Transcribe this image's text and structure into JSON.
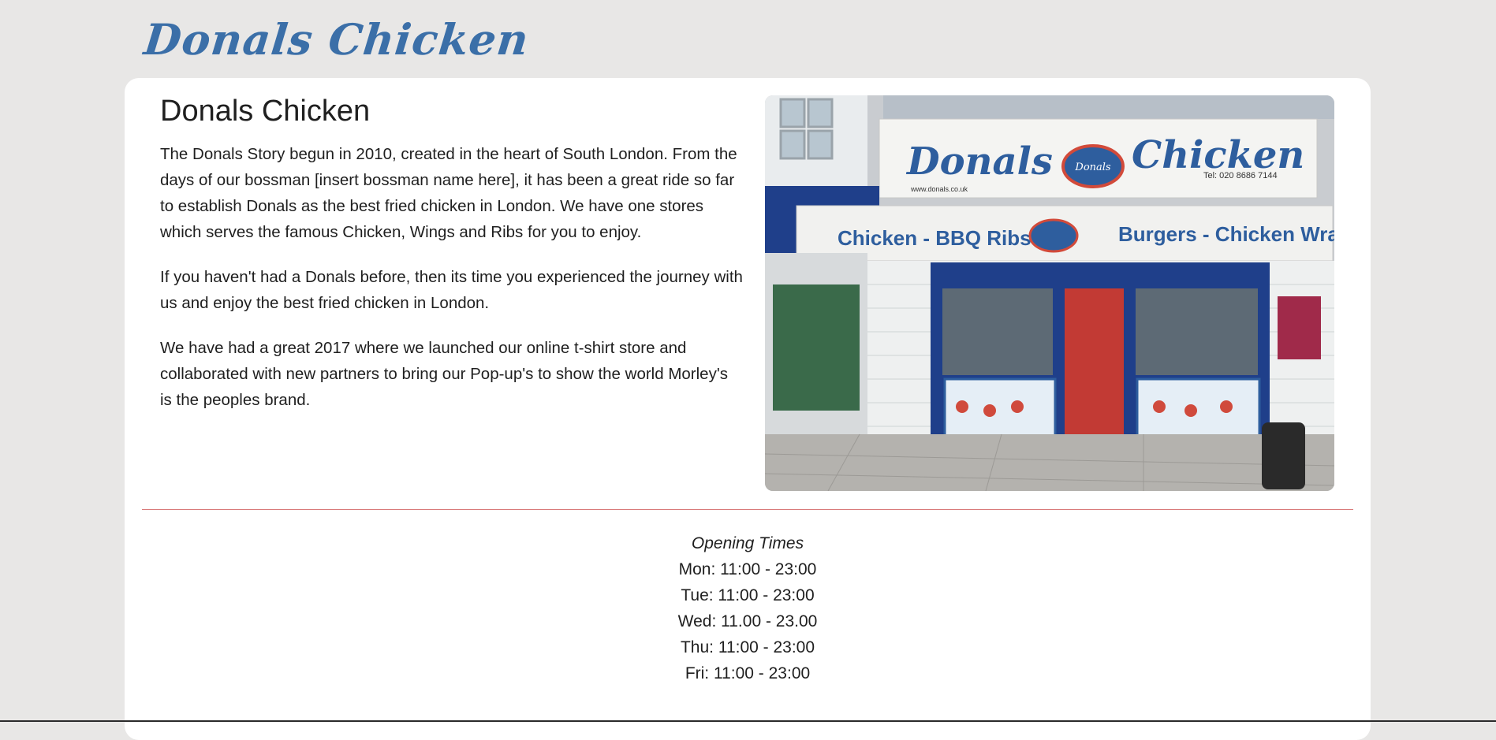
{
  "header": {
    "logo_text": "Donals Chicken"
  },
  "intro": {
    "title": "Donals Chicken",
    "paragraphs": [
      "The Donals Story begun in 2010, created in the heart of South London. From the days of our bossman [insert bossman name here], it has been a great ride so far to establish Donals as the best fried chicken in London. We have one stores which serves the famous Chicken, Wings and Ribs for you to enjoy.",
      "If you haven't had a Donals before, then its time you experienced the journey with us and enjoy the best fried chicken in London.",
      "We have had a great 2017 where we launched our online t-shirt store and collaborated with new partners to bring our Pop-up's to show the world Morley's is the peoples brand."
    ]
  },
  "photo": {
    "sign_top_left": "Donals",
    "sign_top_right": "Chicken",
    "sign_phone": "Tel: 020 8686 7144",
    "sign_web": "www.donals.co.uk",
    "sign_bottom_left": "Chicken - BBQ Ribs",
    "sign_bottom_right": "Burgers - Chicken Wraps",
    "badge_text": "Donals",
    "colors": {
      "sign_blue": "#2e5e9e",
      "frame_blue": "#1f3f8a"
    }
  },
  "hours": {
    "title": "Opening Times",
    "lines": [
      "Mon: 11:00 - 23:00",
      "Tue: 11:00 - 23:00",
      "Wed: 11.00 - 23.00",
      "Thu: 11:00 - 23:00",
      "Fri: 11:00 - 23:00"
    ]
  },
  "colors": {
    "background": "#e8e7e6",
    "card": "#ffffff",
    "logo": "#3b6fa8",
    "divider": "#d97b7b"
  }
}
